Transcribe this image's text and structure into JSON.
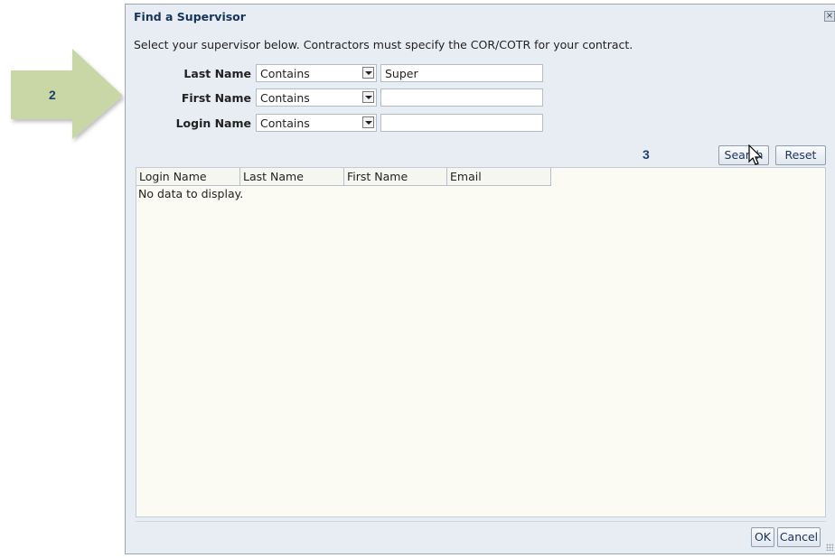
{
  "callouts": [
    {
      "number": "2"
    },
    {
      "number": "3"
    }
  ],
  "dialog": {
    "title": "Find a Supervisor",
    "instruction": "Select your supervisor below. Contractors must specify the COR/COTR for your contract.",
    "fields": [
      {
        "label": "Last Name",
        "operator": "Contains",
        "value": "Super"
      },
      {
        "label": "First Name",
        "operator": "Contains",
        "value": ""
      },
      {
        "label": "Login Name",
        "operator": "Contains",
        "value": ""
      }
    ],
    "search_label": "Search",
    "reset_label": "Reset",
    "table": {
      "columns": [
        "Login Name",
        "Last Name",
        "First Name",
        "Email"
      ],
      "empty_message": "No data to display."
    },
    "ok_label": "OK",
    "cancel_label": "Cancel"
  },
  "colors": {
    "arrow_fill": "#c9d6a5",
    "dialog_bg": "#e8edf3",
    "table_bg": "#fbfbf3",
    "title_color": "#17355a"
  }
}
